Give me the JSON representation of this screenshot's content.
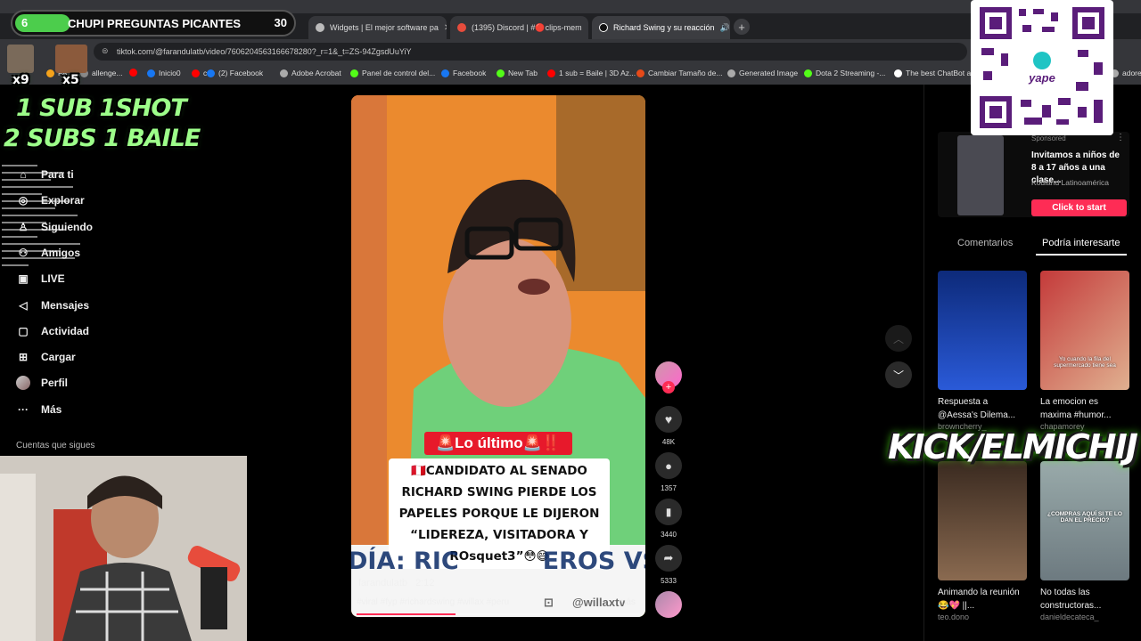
{
  "overlay": {
    "banner": {
      "left_num": "6",
      "title": "CHUPI PREGUNTAS PICANTES",
      "right_num": "30"
    },
    "counters": [
      {
        "label": "x9"
      },
      {
        "label": "x5"
      }
    ],
    "promo_line1": "1 SUB  1SHOT",
    "promo_line2": "2 SUBS 1 BAILE",
    "kick_text": "KICK/ELMICHIJ",
    "qr_brand": "yape"
  },
  "browser": {
    "tabs": [
      {
        "label": "Widgets | El mejor software pa"
      },
      {
        "label": "(1395) Discord | #🔴clips-mem"
      },
      {
        "label": "Richard Swing y su reacción"
      }
    ],
    "new_tab_icon": "plus-icon",
    "url": "tiktok.com/@farandulatb/video/7606204563166678280?_r=1&_t=ZS-94ZgsdUuYiY",
    "bookmarks": [
      {
        "label": "FA",
        "color": "#f4a21b"
      },
      {
        "label": "allenge...",
        "color": "#888888"
      },
      {
        "label": "",
        "color": "#ff0000"
      },
      {
        "label": "Inicio0",
        "color": "#1877f2"
      },
      {
        "label": "c",
        "color": "#ff0000"
      },
      {
        "label": "(2) Facebook",
        "color": "#1877f2"
      },
      {
        "label": "Adobe Acrobat",
        "color": "#aaaaaa"
      },
      {
        "label": "Panel de control del...",
        "color": "#53fc18"
      },
      {
        "label": "Facebook",
        "color": "#1877f2"
      },
      {
        "label": "New Tab",
        "color": "#53fc18"
      },
      {
        "label": "1 sub = Baile | 3D Az...",
        "color": "#ff0000"
      },
      {
        "label": "Cambiar Tamaño de...",
        "color": "#e64a19"
      },
      {
        "label": "Generated Image",
        "color": "#aaaaaa"
      },
      {
        "label": "Dota 2 Streaming -...",
        "color": "#53fc18"
      },
      {
        "label": "The best ChatBot an...",
        "color": "#ffffff"
      },
      {
        "label": "adores",
        "color": "#aaaaaa"
      }
    ]
  },
  "sidebar": {
    "items": [
      {
        "label": "Para ti",
        "icon": "home-icon"
      },
      {
        "label": "Explorar",
        "icon": "compass-icon"
      },
      {
        "label": "Siguiendo",
        "icon": "following-icon"
      },
      {
        "label": "Amigos",
        "icon": "friends-icon"
      },
      {
        "label": "LIVE",
        "icon": "live-icon"
      },
      {
        "label": "Mensajes",
        "icon": "send-icon"
      },
      {
        "label": "Actividad",
        "icon": "inbox-icon"
      },
      {
        "label": "Cargar",
        "icon": "upload-icon"
      },
      {
        "label": "Perfil",
        "icon": "avatar"
      },
      {
        "label": "Más",
        "icon": "more-icon"
      }
    ],
    "following_header": "Cuentas que sigues"
  },
  "video": {
    "badge": "🚨Lo último🚨‼️",
    "headline_lines": [
      "🇵🇪CANDIDATO AL SENADO",
      "RICHARD SWING PIERDE LOS",
      "PAPELES PORQUE LE DIJERON",
      "“LIDEREZA, VISITADORA Y",
      "ROsquet3”😳😅"
    ],
    "banner_text": "DÍA: RIC          EROS VS",
    "author": "farandulatb",
    "time": "2:12",
    "caption": "#viral #fyp #richardswing #willax #peru",
    "watermark": "@willaxtv",
    "more": "más",
    "progress": 0.35
  },
  "actions": {
    "likes": "48K",
    "comments": "1357",
    "saves": "3440",
    "shares": "5333"
  },
  "right_panel": {
    "sponsored_label": "Sponsored",
    "ad_title": "Invitamos a niños de 8 a 17 años a una clase...",
    "ad_advertiser": "Kodland Latinoamérica",
    "ad_cta": "Click to start",
    "tabs": [
      "Comentarios",
      "Podría interesarte"
    ],
    "videos": [
      {
        "title": "Respuesta a @Aessa's Dilema...",
        "author": "browncherry_",
        "thumb_text": ""
      },
      {
        "title": "La emocion es maxima #humor...",
        "author": "chapamorey",
        "thumb_text": "Yo cuando la fila del supermercado tiene sea"
      },
      {
        "title": "Animando la reunión 😂💖 ||...",
        "author": "teo.dono",
        "thumb_text": ""
      },
      {
        "title": "No todas las constructoras...",
        "author": "danieldecateca_",
        "thumb_text": "¿COMPRAS AQUÍ SI TE LO DAN EL PRECIO?"
      }
    ]
  },
  "colors": {
    "tiktok_red": "#fe2c55",
    "kick_green": "#53fc18",
    "overlay_green": "#4ccd4c"
  }
}
